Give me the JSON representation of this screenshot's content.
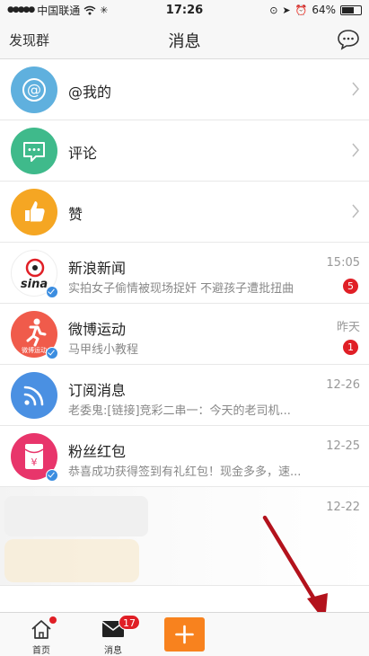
{
  "status": {
    "carrier": "中国联通",
    "time": "17:26",
    "battery": "64%",
    "battery_level": 0.64
  },
  "nav": {
    "left": "发现群",
    "title": "消息"
  },
  "rows": [
    {
      "title": "@我的"
    },
    {
      "title": "评论"
    },
    {
      "title": "赞"
    },
    {
      "title": "新浪新闻",
      "sub": "实拍女子偷情被现场捉奸 不避孩子遭批扭曲",
      "time": "15:05",
      "badge": "5",
      "avatar_text": "sina"
    },
    {
      "title": "微博运动",
      "sub": "马甲线小教程",
      "time": "昨天",
      "badge": "1",
      "avatar_text": "微博运动"
    },
    {
      "title": "订阅消息",
      "sub": "老委鬼:[链接]竞彩二串一：今天的老司机...",
      "time": "12-26"
    },
    {
      "title": "粉丝红包",
      "sub": "恭喜成功获得签到有礼红包！现金多多，速...",
      "time": "12-25"
    }
  ],
  "blurred_row": {
    "time": "12-22"
  },
  "tabs": {
    "home": "首页",
    "messages": "消息",
    "messages_badge": "17"
  },
  "colors": {
    "at_blue": "#5fb0de",
    "comment_green": "#3fba8b",
    "like_orange": "#f5a623",
    "subscribe_blue": "#4a90e2",
    "redpacket": "#e8356b",
    "sport_red": "#f05b4b",
    "accent_orange": "#f8821e",
    "badge_red": "#e01f26"
  }
}
